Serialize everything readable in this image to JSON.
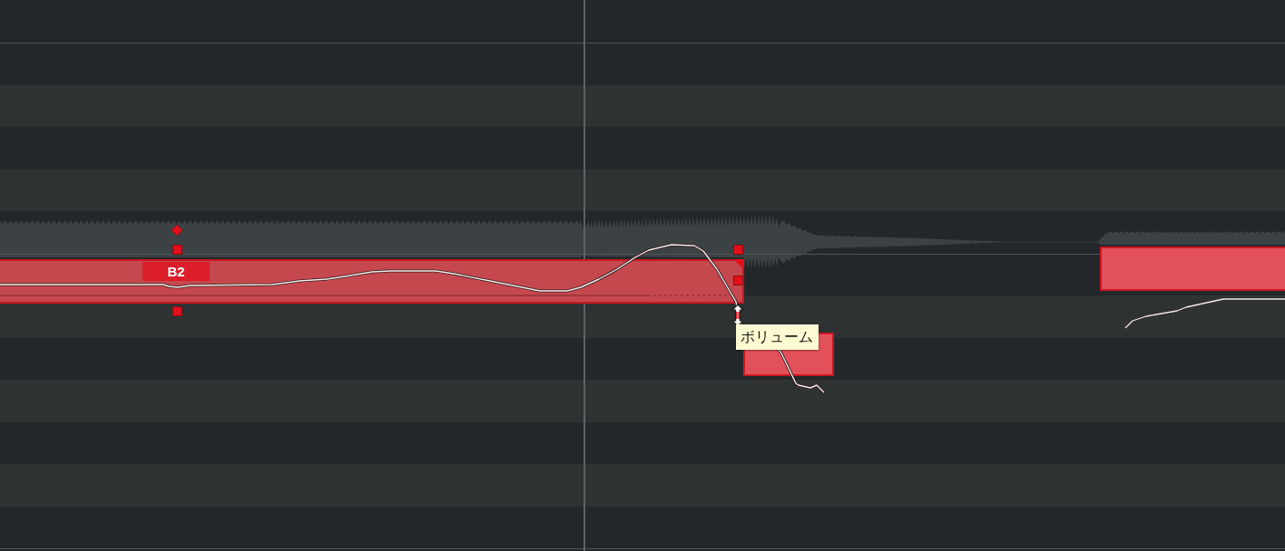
{
  "editor": {
    "lanes": [
      {
        "kind": "natural"
      },
      {
        "kind": "natural"
      },
      {
        "kind": "sharp"
      },
      {
        "kind": "natural"
      },
      {
        "kind": "sharp"
      },
      {
        "kind": "natural"
      },
      {
        "kind": "natural"
      },
      {
        "kind": "sharp"
      },
      {
        "kind": "natural"
      },
      {
        "kind": "sharp"
      },
      {
        "kind": "natural"
      },
      {
        "kind": "sharp"
      },
      {
        "kind": "natural"
      },
      {
        "kind": "natural"
      }
    ],
    "notes": [
      {
        "label": "B2",
        "selected": true
      },
      {
        "selected": false
      },
      {
        "selected": false
      }
    ],
    "tooltip": {
      "text": "ボリューム"
    }
  }
}
